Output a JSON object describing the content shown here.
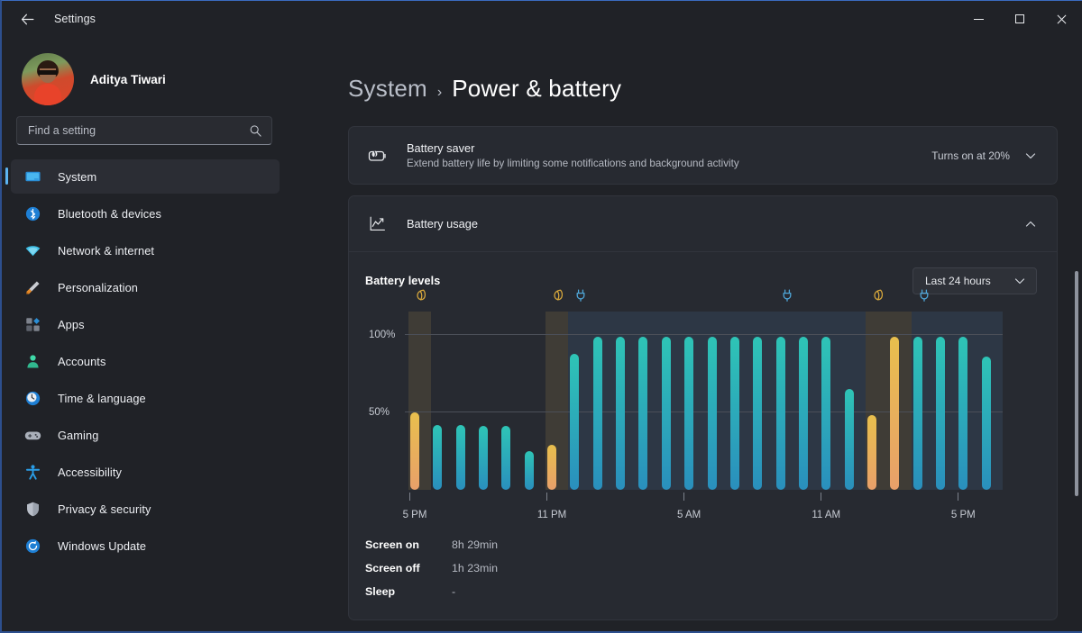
{
  "window": {
    "title": "Settings",
    "back_icon": "arrow-left-icon",
    "minimize_label": "Minimize",
    "maximize_label": "Maximize",
    "close_label": "Close"
  },
  "sidebar": {
    "profile": {
      "name": "Aditya Tiwari",
      "avatar": "user-avatar"
    },
    "search": {
      "placeholder": "Find a setting",
      "value": "",
      "icon": "search-icon"
    },
    "items": [
      {
        "label": "System",
        "icon": "monitor-icon",
        "active": true
      },
      {
        "label": "Bluetooth & devices",
        "icon": "bluetooth-icon",
        "active": false
      },
      {
        "label": "Network & internet",
        "icon": "wifi-icon",
        "active": false
      },
      {
        "label": "Personalization",
        "icon": "paintbrush-icon",
        "active": false
      },
      {
        "label": "Apps",
        "icon": "apps-icon",
        "active": false
      },
      {
        "label": "Accounts",
        "icon": "person-icon",
        "active": false
      },
      {
        "label": "Time & language",
        "icon": "clock-icon",
        "active": false
      },
      {
        "label": "Gaming",
        "icon": "gamepad-icon",
        "active": false
      },
      {
        "label": "Accessibility",
        "icon": "accessibility-icon",
        "active": false
      },
      {
        "label": "Privacy & security",
        "icon": "shield-icon",
        "active": false
      },
      {
        "label": "Windows Update",
        "icon": "update-icon",
        "active": false
      }
    ]
  },
  "breadcrumb": {
    "root": "System",
    "separator": "›",
    "leaf": "Power & battery"
  },
  "battery_saver": {
    "icon": "battery-saver-icon",
    "title": "Battery saver",
    "subtitle": "Extend battery life by limiting some notifications and background activity",
    "value": "Turns on at 20%",
    "chevron": "chevron-down-icon"
  },
  "battery_usage": {
    "icon": "chart-line-icon",
    "title": "Battery usage",
    "chevron": "chevron-up-icon",
    "levels_title": "Battery levels",
    "range": {
      "selected": "Last 24 hours",
      "chevron": "chevron-down-icon"
    }
  },
  "stats": [
    {
      "key": "Screen on",
      "value": "8h 29min"
    },
    {
      "key": "Screen off",
      "value": "1h 23min"
    },
    {
      "key": "Sleep",
      "value": "-"
    }
  ],
  "colors": {
    "accent": "#5db5f2",
    "bar_normal_top": "#2ec4b6",
    "bar_normal_bottom": "#2a8fbd",
    "bar_saver_top": "#e8bf4d",
    "bar_saver_bottom": "#e8a06a",
    "window_bg": "#202227",
    "card_bg": "#272a31"
  },
  "chart_data": {
    "type": "bar",
    "title": "Battery levels",
    "xlabel": "",
    "ylabel": "",
    "ylim": [
      0,
      115
    ],
    "ytick_labels": [
      "50%",
      "100%"
    ],
    "ytick_values": [
      50,
      100
    ],
    "grid": true,
    "legend": null,
    "xtick_labels": [
      "5 PM",
      "11 PM",
      "5 AM",
      "11 AM",
      "5 PM"
    ],
    "xtick_values": [
      0,
      6,
      12,
      18,
      24
    ],
    "categories": [
      "5 PM",
      "6 PM",
      "7 PM",
      "8 PM",
      "9 PM",
      "10 PM",
      "11 PM",
      "12 AM",
      "1 AM",
      "2 AM",
      "3 AM",
      "4 AM",
      "5 AM",
      "6 AM",
      "7 AM",
      "8 AM",
      "9 AM",
      "10 AM",
      "11 AM",
      "12 PM",
      "1 PM",
      "2 PM",
      "3 PM",
      "4 PM",
      "5 PM"
    ],
    "values": [
      50,
      42,
      42,
      41,
      41,
      25,
      29,
      88,
      99,
      99,
      99,
      99,
      99,
      99,
      99,
      99,
      99,
      99,
      99,
      65,
      48,
      99,
      99,
      99,
      99,
      86
    ],
    "bar_states": [
      "saver",
      "normal",
      "normal",
      "normal",
      "normal",
      "normal",
      "saver",
      "normal",
      "normal",
      "normal",
      "normal",
      "normal",
      "normal",
      "normal",
      "normal",
      "normal",
      "normal",
      "normal",
      "normal",
      "normal",
      "saver",
      "saver",
      "normal",
      "normal",
      "normal",
      "normal"
    ],
    "regions": [
      {
        "type": "saver",
        "start_index": 0,
        "end_index": 1,
        "icon": "leaf-icon"
      },
      {
        "type": "saver",
        "start_index": 6,
        "end_index": 7,
        "icon": "leaf-icon"
      },
      {
        "type": "charge",
        "start_index": 7,
        "end_index": 16,
        "icon": "plug-icon"
      },
      {
        "type": "charge",
        "start_index": 16,
        "end_index": 20,
        "icon": "plug-icon"
      },
      {
        "type": "saver",
        "start_index": 20,
        "end_index": 22,
        "icon": "leaf-icon"
      },
      {
        "type": "charge",
        "start_index": 22,
        "end_index": 26,
        "icon": "plug-icon"
      }
    ]
  }
}
